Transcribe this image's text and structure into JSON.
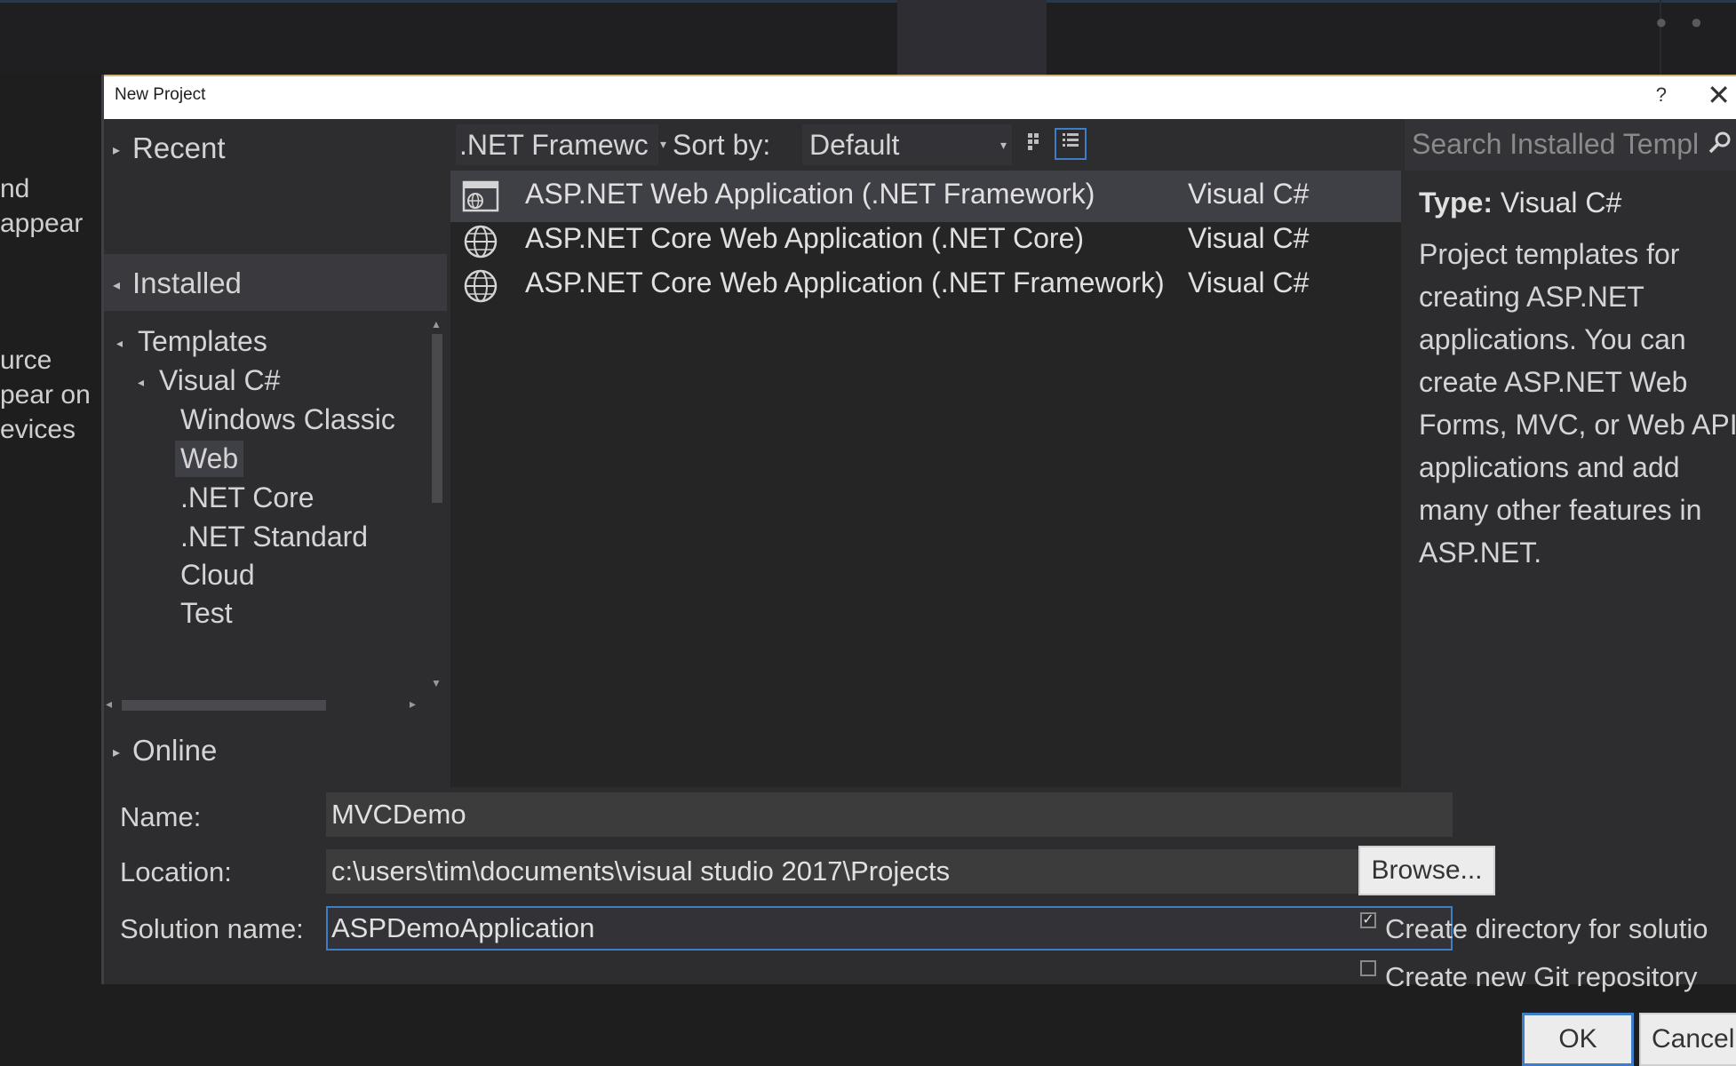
{
  "background": {
    "left_text": [
      "nd",
      "appear",
      "urce",
      "pear on",
      "evices"
    ]
  },
  "dialog": {
    "title": "New Project",
    "help": "?",
    "close": "✕"
  },
  "nav": {
    "recent": "Recent",
    "installed": "Installed",
    "online": "Online",
    "tree": {
      "templates": "Templates",
      "visual_csharp": "Visual C#",
      "children": [
        "Windows Classic",
        "Web",
        ".NET Core",
        ".NET Standard",
        "Cloud",
        "Test"
      ],
      "selected": "Web"
    }
  },
  "toolbar": {
    "framework": ".NET Framewc",
    "sort_label": "Sort by:",
    "sort_value": "Default"
  },
  "templates": [
    {
      "name": "ASP.NET Web Application (.NET Framework)",
      "lang": "Visual C#",
      "icon": "web-app-icon",
      "selected": true
    },
    {
      "name": "ASP.NET Core Web Application (.NET Core)",
      "lang": "Visual C#",
      "icon": "globe-icon",
      "selected": false
    },
    {
      "name": "ASP.NET Core Web Application (.NET Framework)",
      "lang": "Visual C#",
      "icon": "globe-icon",
      "selected": false
    }
  ],
  "search": {
    "placeholder": "Search Installed Templ"
  },
  "description": {
    "type_label": "Type:",
    "type_value": "Visual C#",
    "text": "Project templates for creating ASP.NET applications. You can create ASP.NET Web Forms, MVC, or Web API applications and add many other features in ASP.NET."
  },
  "form": {
    "name_label": "Name:",
    "name_value": "MVCDemo",
    "location_label": "Location:",
    "location_value": "c:\\users\\tim\\documents\\visual studio 2017\\Projects",
    "solution_label": "Solution name:",
    "solution_value": "ASPDemoApplication",
    "browse": "Browse...",
    "create_dir": "Create directory for solutio",
    "create_dir_checked": true,
    "create_git": "Create new Git repository",
    "create_git_checked": false,
    "ok": "OK",
    "cancel": "Cancel"
  },
  "colors": {
    "dialog_bg": "#2d2d30",
    "list_bg": "#252526",
    "selection": "#3f3f46",
    "accent": "#3e7ec9"
  }
}
